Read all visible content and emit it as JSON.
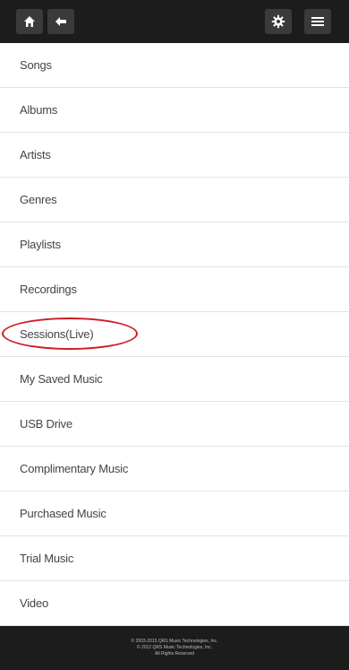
{
  "toolbar": {
    "home_icon": "home-icon",
    "back_icon": "back-arrow-icon",
    "settings_icon": "gear-icon",
    "menu_icon": "menu-icon"
  },
  "menu": {
    "items": [
      {
        "label": "Songs"
      },
      {
        "label": "Albums"
      },
      {
        "label": "Artists"
      },
      {
        "label": "Genres"
      },
      {
        "label": "Playlists"
      },
      {
        "label": "Recordings"
      },
      {
        "label": "Sessions(Live)"
      },
      {
        "label": "My Saved Music"
      },
      {
        "label": "USB Drive"
      },
      {
        "label": "Complimentary Music"
      },
      {
        "label": "Purchased Music"
      },
      {
        "label": "Trial Music"
      },
      {
        "label": "Video"
      }
    ],
    "highlighted_item": "Sessions(Live)",
    "highlight_color": "#d01b24"
  },
  "footer": {
    "lines": [
      "© 2003-2015 QRS Music Technologies, Inc.",
      "© 2012 QRS Music Technologies, Inc.",
      "All Rights Reserved"
    ]
  },
  "colors": {
    "bar_background": "#1c1c1c",
    "button_background": "#3a3a3a",
    "divider": "#e3e3e3",
    "text": "#444444"
  }
}
